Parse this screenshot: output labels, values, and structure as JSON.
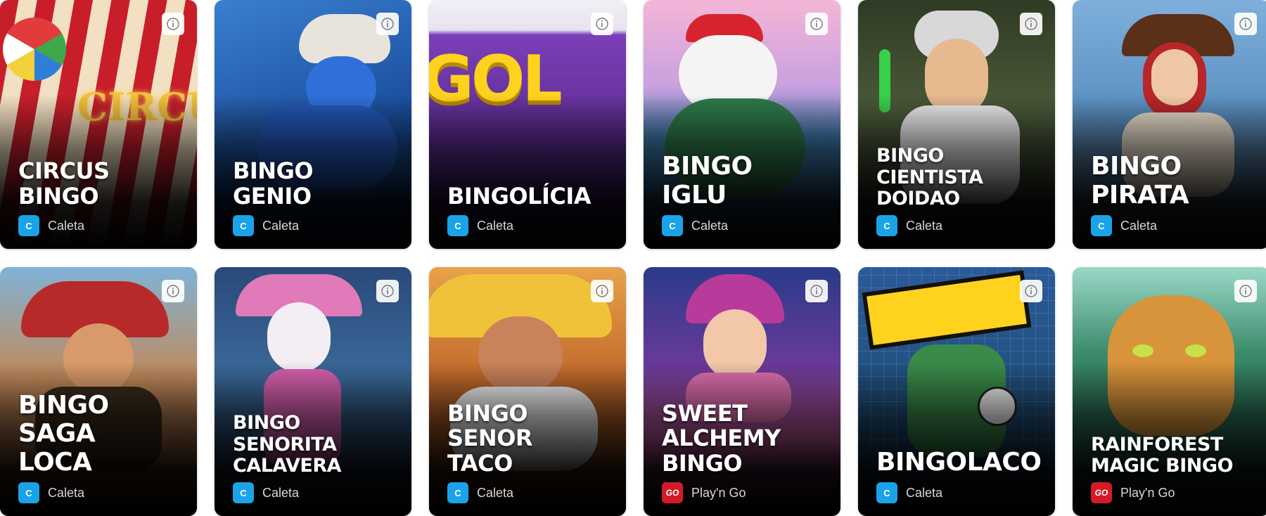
{
  "games": [
    {
      "title": "CIRCUS\nBINGO",
      "provider": "Caleta",
      "provider_icon": "caleta-icon",
      "bg": "#7a1a1a"
    },
    {
      "title": "BINGO GENIO",
      "provider": "Caleta",
      "provider_icon": "caleta-icon",
      "bg": "#1d4f9c"
    },
    {
      "title": "BINGOLÍCIA",
      "provider": "Caleta",
      "provider_icon": "caleta-icon",
      "bg": "#5b2a8c"
    },
    {
      "title": "BINGO\nIGLU",
      "provider": "Caleta",
      "provider_icon": "caleta-icon",
      "bg": "#3d7fb3"
    },
    {
      "title": "BINGO CIENTISTA\nDOIDAO",
      "provider": "Caleta",
      "provider_icon": "caleta-icon",
      "bg": "#4b5a3a"
    },
    {
      "title": "BINGO\nPIRATA",
      "provider": "Caleta",
      "provider_icon": "caleta-icon",
      "bg": "#6a8fb5"
    },
    {
      "title": "BINGO SAGA\nLOCA",
      "provider": "Caleta",
      "provider_icon": "caleta-icon",
      "bg": "#8a4a2a"
    },
    {
      "title": "BINGO SENORITA\nCALAVERA",
      "provider": "Caleta",
      "provider_icon": "caleta-icon",
      "bg": "#3a5f8a"
    },
    {
      "title": "BINGO SENOR\nTACO",
      "provider": "Caleta",
      "provider_icon": "caleta-icon",
      "bg": "#c26a2a"
    },
    {
      "title": "SWEET\nALCHEMY\nBINGO",
      "provider": "Play'n Go",
      "provider_icon": "playngo-icon",
      "bg": "#8a3a8a"
    },
    {
      "title": "BINGOLACO",
      "provider": "Caleta",
      "provider_icon": "caleta-icon",
      "bg": "#1f4f7a"
    },
    {
      "title": "RAINFOREST\nMAGIC BINGO",
      "provider": "Play'n Go",
      "provider_icon": "playngo-icon",
      "bg": "#2a6a4a"
    }
  ],
  "provider_logos": {
    "caleta": "C",
    "playngo": "GO"
  },
  "info_icon": "info-icon",
  "colors": {
    "caleta": "#1aa3e8",
    "playngo": "#d31b27"
  }
}
